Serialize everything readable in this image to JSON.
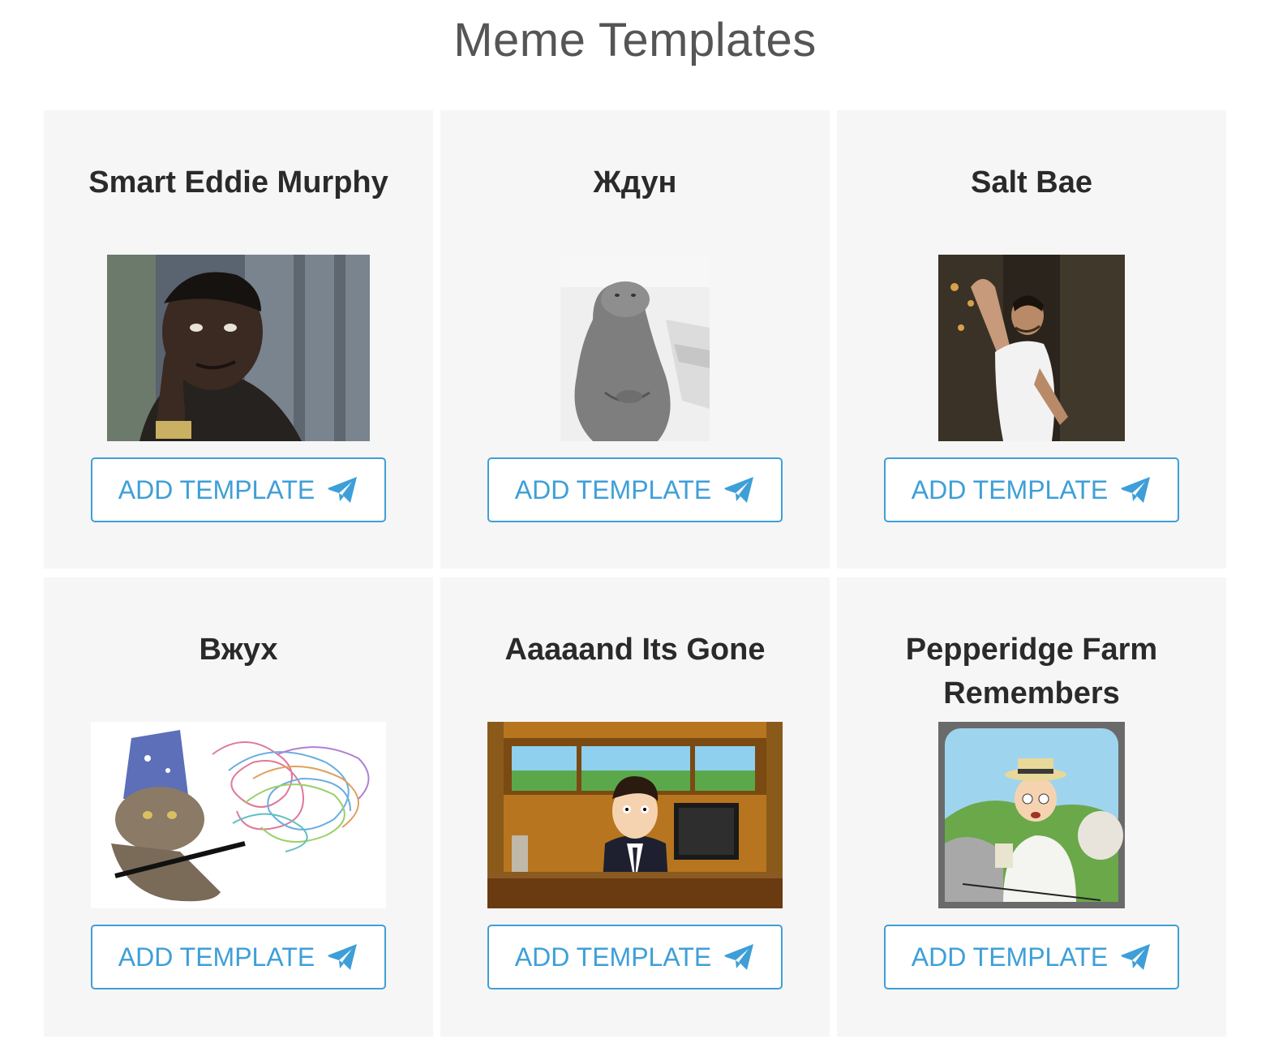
{
  "page": {
    "title": "Meme Templates"
  },
  "button": {
    "label": "ADD TEMPLATE",
    "icon": "paper-plane-icon",
    "color": "#3e9fd8"
  },
  "templates": [
    {
      "name": "Smart Eddie Murphy"
    },
    {
      "name": "Ждун"
    },
    {
      "name": "Salt Bae"
    },
    {
      "name": "Вжух"
    },
    {
      "name": "Aaaaand Its Gone"
    },
    {
      "name": "Pepperidge Farm Remembers"
    }
  ],
  "colors": {
    "card_background": "#f6f6f6",
    "title_text": "#555555",
    "accent": "#3e9fd8"
  }
}
